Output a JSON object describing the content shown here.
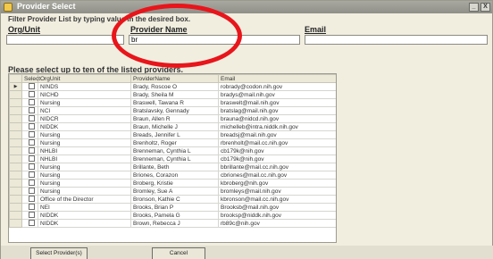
{
  "window": {
    "title": "Provider Select",
    "minimize": "_",
    "close": "X"
  },
  "filter": {
    "header": "Filter Provider List by typing value in the desired box.",
    "org_unit_label": "Org/Unit",
    "provider_name_label": "Provider Name",
    "email_label": "Email",
    "org_unit_value": "",
    "provider_name_value": "br",
    "email_value": ""
  },
  "select_message": "Please select up to ten of the listed providers.",
  "table": {
    "columns": [
      "",
      "Select",
      "OrgUnit",
      "ProviderName",
      "Email"
    ],
    "rows": [
      {
        "org": "NINDS",
        "name": "Brady, Roscoe O",
        "email": "robrady@codon.nih.gov"
      },
      {
        "org": "NICHD",
        "name": "Brady, Sheila M",
        "email": "bradys@mail.nih.gov"
      },
      {
        "org": "Nursing",
        "name": "Braswell, Tawana R",
        "email": "braswelt@mail.nih.gov"
      },
      {
        "org": "NCI",
        "name": "Bratslavsky, Gennady",
        "email": "bratslag@mail.nih.gov"
      },
      {
        "org": "NIDCR",
        "name": "Braun, Allen R",
        "email": "brauna@nidcd.nih.gov"
      },
      {
        "org": "NIDDK",
        "name": "Braun, Michelle J",
        "email": "michelleb@intra.niddk.nih.gov"
      },
      {
        "org": "Nursing",
        "name": "Breads, Jennifer L",
        "email": "breadsj@mail.nih.gov"
      },
      {
        "org": "Nursing",
        "name": "Brenholtz, Roger",
        "email": "rbrenholt@mail.cc.nih.gov"
      },
      {
        "org": "NHLBI",
        "name": "Brenneman, Cynthia L",
        "email": "cb179k@nih.gov"
      },
      {
        "org": "NHLBI",
        "name": "Brenneman, Cynthia L",
        "email": "cb179k@nih.gov"
      },
      {
        "org": "Nursing",
        "name": "Brillante, Beth",
        "email": "bbrillante@mail.cc.nih.gov"
      },
      {
        "org": "Nursing",
        "name": "Briones, Corazon",
        "email": "cbriones@mail.cc.nih.gov"
      },
      {
        "org": "Nursing",
        "name": "Broberg, Kristie",
        "email": "kbroberg@nih.gov"
      },
      {
        "org": "Nursing",
        "name": "Bromley, Sue A",
        "email": "bromleys@mail.nih.gov"
      },
      {
        "org": "Office of the Director",
        "name": "Bronson, Kathie C",
        "email": "kbronson@mail.cc.nih.gov"
      },
      {
        "org": "NEI",
        "name": "Brooks, Brian P",
        "email": "Brooksb@mail.nih.gov"
      },
      {
        "org": "NIDDK",
        "name": "Brooks, Pamela G",
        "email": "brooksp@niddk.nih.gov"
      },
      {
        "org": "NIDDK",
        "name": "Brown, Rebecca J",
        "email": "rb89c@nih.gov"
      }
    ]
  },
  "buttons": {
    "select": "Select Provider(s)",
    "cancel": "Cancel"
  }
}
